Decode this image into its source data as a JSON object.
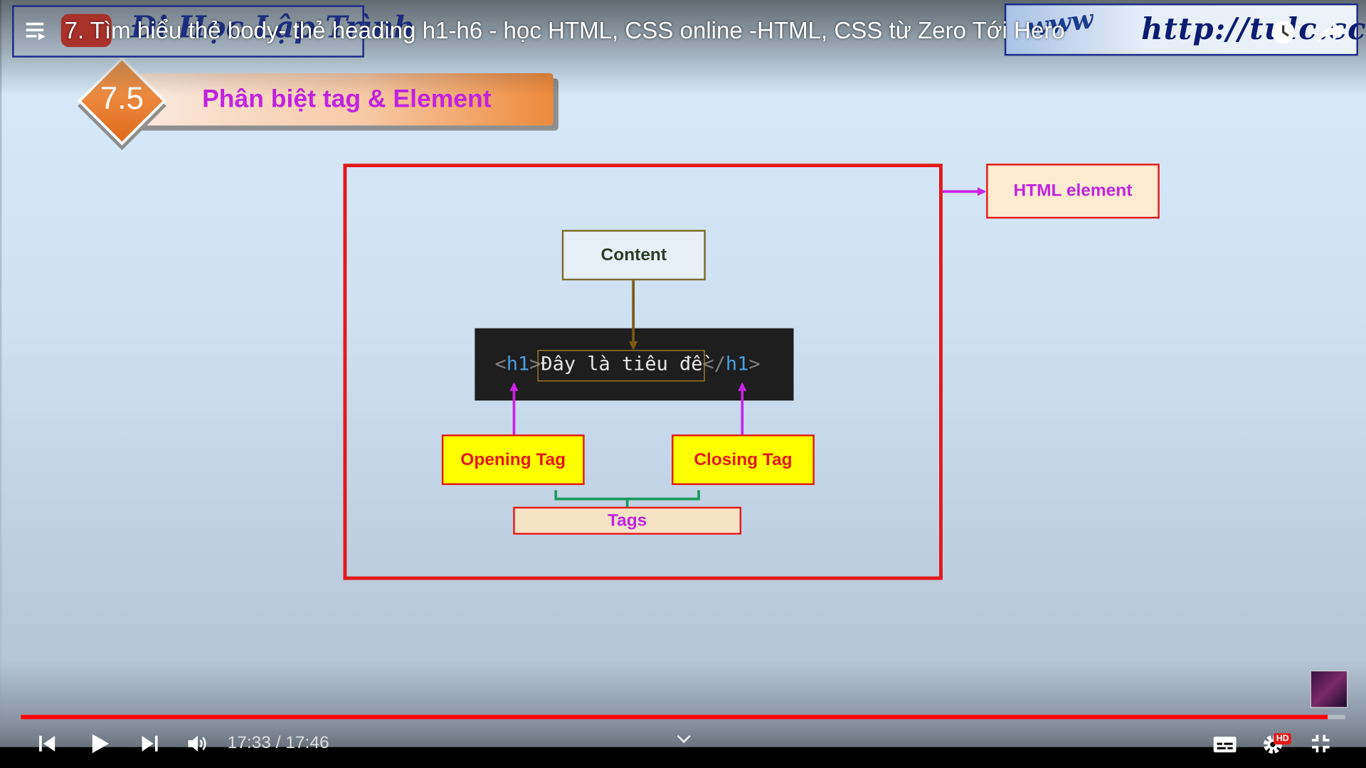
{
  "player": {
    "video_title": "7. Tìm hiểu thẻ body- thẻ heading h1-h6 - học HTML, CSS online -HTML, CSS từ Zero Tới Hero",
    "watermark_text": "Đi Học Lập Trình",
    "site_banner_www": "www",
    "site_banner_url": "http://tulc.cc",
    "current_time": "17:33",
    "separator": " / ",
    "duration": "17:46",
    "progress_fraction": 0.987,
    "hd_badge": "HD",
    "icons": [
      "menu-icon",
      "watch-later-icon",
      "share-icon",
      "skip-previous-icon",
      "play-icon",
      "skip-next-icon",
      "volume-icon",
      "chevron-down-icon",
      "subtitles-icon",
      "settings-icon",
      "exit-fullscreen-icon"
    ]
  },
  "slide": {
    "section_number": "7.5",
    "section_title": "Phân biệt tag & Element",
    "labels": {
      "html_element": "HTML element",
      "content": "Content",
      "opening_tag": "Opening Tag",
      "closing_tag": "Closing Tag",
      "tags": "Tags"
    },
    "code": {
      "open_lt": "<",
      "open_name": "h1",
      "open_gt": ">",
      "text": "Đây là tiêu đề",
      "close_lt": "</",
      "close_name": "h1",
      "close_gt": ">"
    }
  },
  "colors": {
    "frame_red": "#e2191a",
    "title_magenta": "#c024e0",
    "arrow_magenta": "#cc22e6",
    "arrow_brown": "#7a5a12",
    "brace_green": "#1a9a5a",
    "progress_red": "#ff0000"
  }
}
